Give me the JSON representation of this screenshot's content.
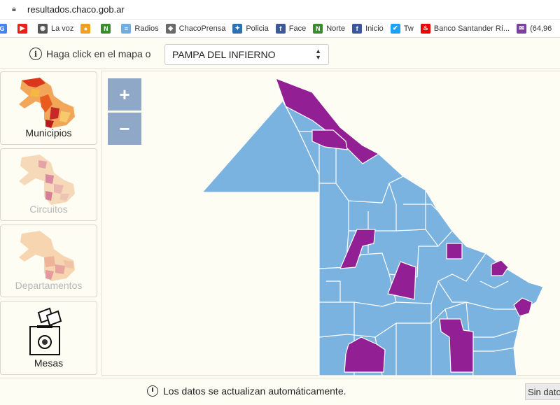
{
  "browser": {
    "url": "resultados.chaco.gob.ar",
    "bookmarks": [
      {
        "label": "",
        "icon": "google-icon",
        "color": "#4285f4",
        "glyph": "G"
      },
      {
        "label": "",
        "icon": "youtube-icon",
        "color": "#e62117",
        "glyph": "▶"
      },
      {
        "label": "La voz",
        "icon": "globe-icon",
        "color": "#555555",
        "glyph": "◉"
      },
      {
        "label": "",
        "icon": "orange-circle-icon",
        "color": "#f0a020",
        "glyph": "●"
      },
      {
        "label": "",
        "icon": "n-green-icon",
        "color": "#3a8a2e",
        "glyph": "N"
      },
      {
        "label": "Radios",
        "icon": "flag-icon",
        "color": "#74acdf",
        "glyph": "≡"
      },
      {
        "label": "ChacoPrensa",
        "icon": "shield-icon",
        "color": "#6a6a6a",
        "glyph": "◈"
      },
      {
        "label": "Policia",
        "icon": "people-icon",
        "color": "#2f6fb0",
        "glyph": "✦"
      },
      {
        "label": "Face",
        "icon": "facebook-icon",
        "color": "#3b5998",
        "glyph": "f"
      },
      {
        "label": "Norte",
        "icon": "n-green-icon",
        "color": "#3a8a2e",
        "glyph": "N"
      },
      {
        "label": "Inicio",
        "icon": "facebook-icon",
        "color": "#3b5998",
        "glyph": "f"
      },
      {
        "label": "Tw",
        "icon": "twitter-icon",
        "color": "#1da1f2",
        "glyph": "✔"
      },
      {
        "label": "Banco Santander Rí...",
        "icon": "santander-icon",
        "color": "#ec0000",
        "glyph": "♨"
      },
      {
        "label": "(64,96",
        "icon": "mail-icon",
        "color": "#7b3fa0",
        "glyph": "✉"
      }
    ]
  },
  "topbar": {
    "hint": "Haga click en el mapa o",
    "selected_location": "PAMPA DEL INFIERNO"
  },
  "sidebar": {
    "items": [
      {
        "label": "Municipios",
        "active": true
      },
      {
        "label": "Circuitos",
        "active": false
      },
      {
        "label": "Departamentos",
        "active": false
      },
      {
        "label": "Mesas",
        "active": true
      }
    ]
  },
  "map": {
    "zoom_in": "+",
    "zoom_out": "−",
    "colors": {
      "blue": "#7bb3e0",
      "purple": "#931f95",
      "border": "#ffffff"
    }
  },
  "footer": {
    "status": "Los datos se actualizan automáticamente.",
    "badge": "Sin datos"
  }
}
